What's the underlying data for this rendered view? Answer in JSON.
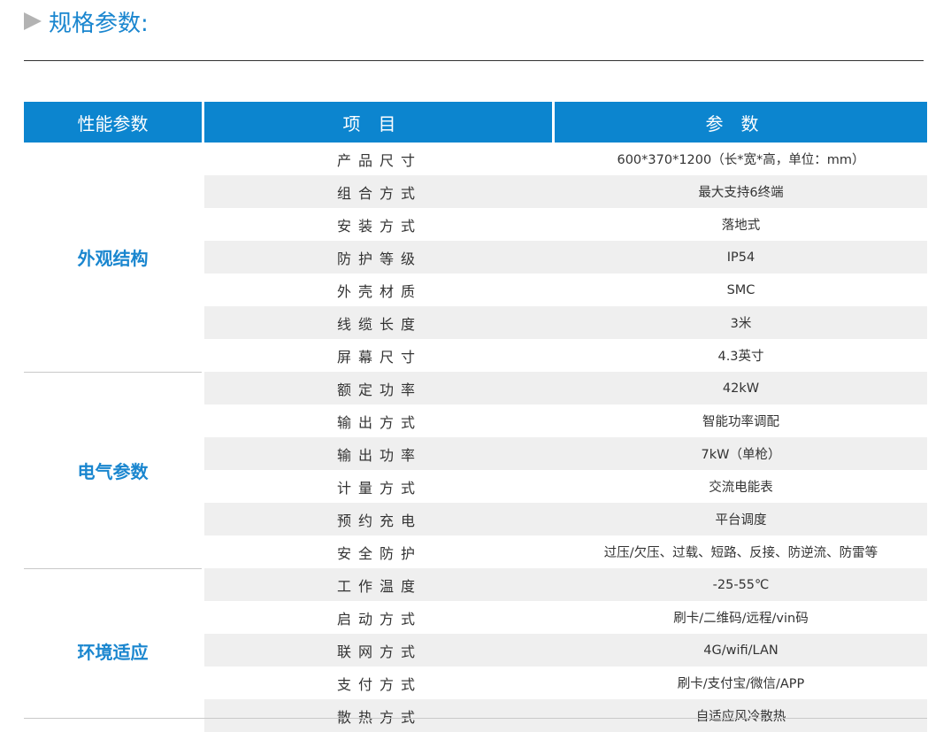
{
  "heading": {
    "icon": "triangle-right-icon",
    "title": "规格参数:"
  },
  "table": {
    "headers": [
      "性能参数",
      "项目",
      "参数"
    ],
    "groups": [
      {
        "category": "外观结构",
        "rows": [
          {
            "item": "产品尺寸",
            "param": "600*370*1200（长*宽*高，单位：mm）"
          },
          {
            "item": "组合方式",
            "param": "最大支持6终端"
          },
          {
            "item": "安装方式",
            "param": "落地式"
          },
          {
            "item": "防护等级",
            "param": "IP54"
          },
          {
            "item": "外壳材质",
            "param": "SMC"
          },
          {
            "item": "线缆长度",
            "param": "3米"
          },
          {
            "item": "屏幕尺寸",
            "param": "4.3英寸"
          }
        ]
      },
      {
        "category": "电气参数",
        "rows": [
          {
            "item": "额定功率",
            "param": "42kW"
          },
          {
            "item": "输出方式",
            "param": "智能功率调配"
          },
          {
            "item": "输出功率",
            "param": "7kW（单枪）"
          },
          {
            "item": "计量方式",
            "param": "交流电能表"
          },
          {
            "item": "预约充电",
            "param": "平台调度"
          },
          {
            "item": "安全防护",
            "param": "过压/欠压、过载、短路、反接、防逆流、防雷等"
          }
        ]
      },
      {
        "category": "环境适应",
        "rows": [
          {
            "item": "工作温度",
            "param": "-25-55℃"
          },
          {
            "item": "启动方式",
            "param": "刷卡/二维码/远程/vin码"
          },
          {
            "item": "联网方式",
            "param": "4G/wifi/LAN"
          },
          {
            "item": "支付方式",
            "param": "刷卡/支付宝/微信/APP"
          },
          {
            "item": "散热方式",
            "param": "自适应风冷散热"
          }
        ]
      }
    ]
  }
}
